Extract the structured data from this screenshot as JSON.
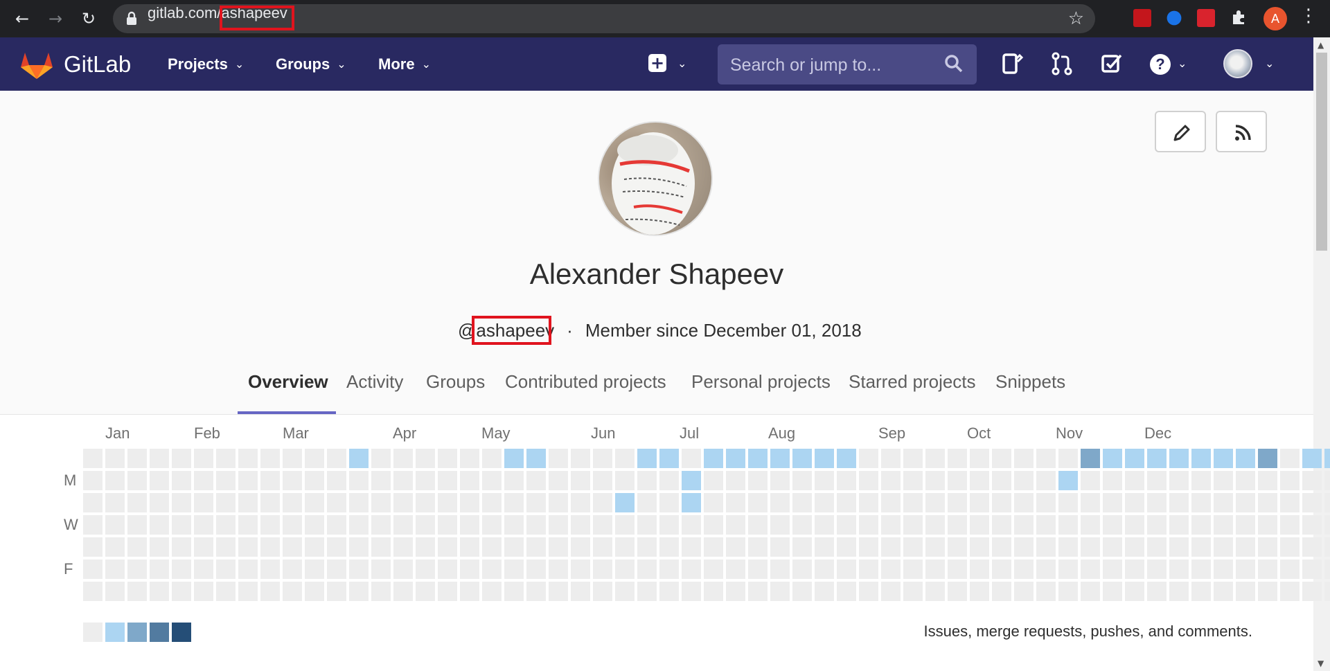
{
  "browser": {
    "url_host": "gitlab.com/",
    "url_path": "ashapeev",
    "profile_initial": "A"
  },
  "header": {
    "brand": "GitLab",
    "nav": [
      "Projects",
      "Groups",
      "More"
    ],
    "search_placeholder": "Search or jump to...",
    "help_label": "?"
  },
  "profile": {
    "name": "Alexander Shapeev",
    "at": "@",
    "username": "ashapeev",
    "separator": "·",
    "member_since": "Member since December 01, 2018"
  },
  "tabs": [
    "Overview",
    "Activity",
    "Groups",
    "Contributed projects",
    "Personal projects",
    "Starred projects",
    "Snippets"
  ],
  "calendar": {
    "months": [
      "Jan",
      "Feb",
      "Mar",
      "Apr",
      "May",
      "Jun",
      "Jul",
      "Aug",
      "Sep",
      "Oct",
      "Nov",
      "Dec"
    ],
    "day_labels": [
      "M",
      "W",
      "F"
    ],
    "legend_text": "Issues, merge requests, pushes, and comments.",
    "colors": [
      "#ededed",
      "#acd5f2",
      "#7fa8c9",
      "#527ba0",
      "#254e77"
    ],
    "rows": [
      "0000000000001000000110000110111111100000000002111111120111",
      "0000000000000000000000000001000000000000000010000000000000",
      "0000000000000000000000001001000000000000000000000000000000",
      "0000000000000000000000000000000000000000000000000000000000",
      "0000000000000000000000000000000000000000000000000000000000",
      "0000000000000000000000000000000000000000000000000000000000",
      "0000000000000000000000000000000000000000000000000000000000"
    ]
  }
}
